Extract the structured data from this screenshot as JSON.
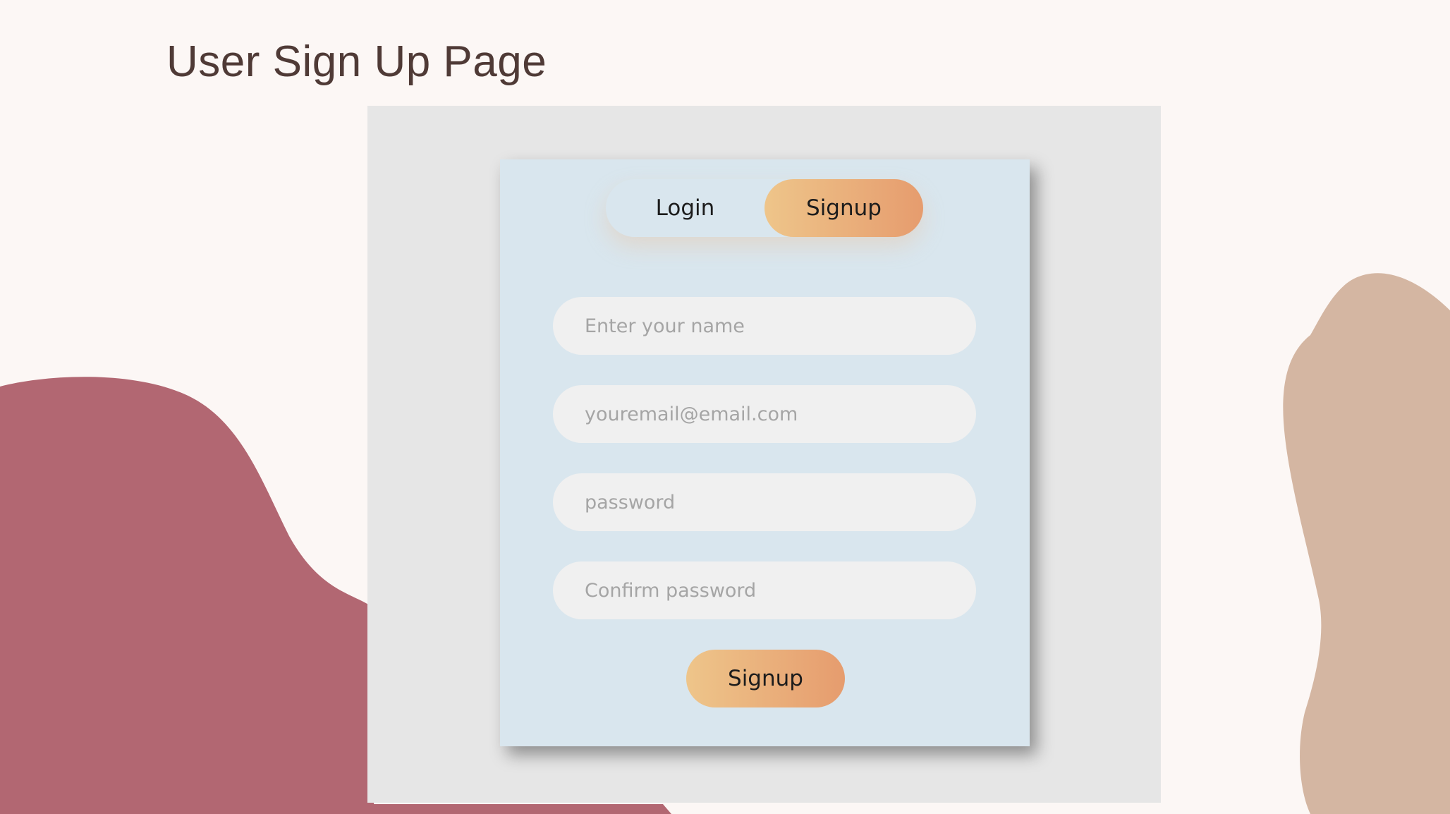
{
  "page": {
    "title": "User Sign Up Page"
  },
  "colors": {
    "background": "#fcf7f5",
    "blob_left": "#b26772",
    "blob_right": "#d4b6a2",
    "panel": "#e6e6e6",
    "card": "#d9e6ee",
    "input_bg": "#f0f0f0",
    "accent_gradient_start": "#eec58a",
    "accent_gradient_end": "#e69c6e",
    "title_text": "#4f3a36"
  },
  "toggle": {
    "login_label": "Login",
    "signup_label": "Signup",
    "active": "Signup"
  },
  "form": {
    "name_placeholder": "Enter your name",
    "email_placeholder": "youremail@email.com",
    "password_placeholder": "password",
    "confirm_placeholder": "Confirm password",
    "submit_label": "Signup"
  }
}
